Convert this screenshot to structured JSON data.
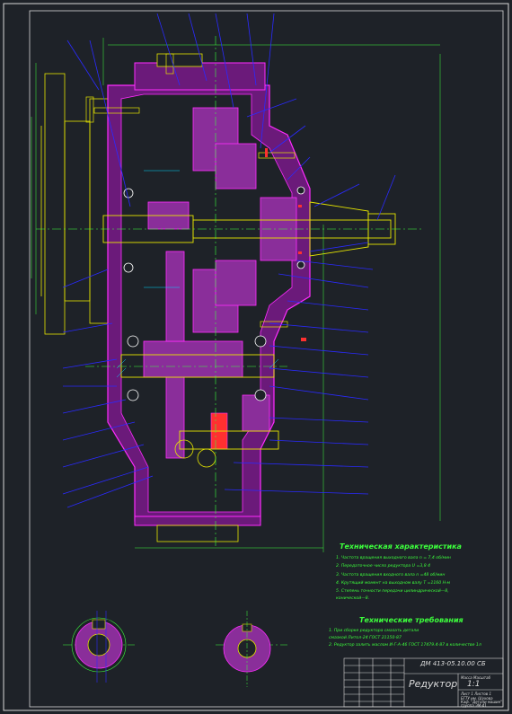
{
  "colors": {
    "background": "#1e2228",
    "frame": "#d8d8d8",
    "body_fill": "#7a1e8c",
    "body_line": "#ff2cff",
    "gear_fill": "#8a2e9a",
    "shaft_line": "#e6e600",
    "leader": "#2a2aff",
    "hatch": "#00d8ff",
    "text_green": "#3cff3c",
    "accent_red": "#ff3030",
    "title_text": "#dcdcdc"
  },
  "tech_characteristics": {
    "heading": "Техническая характеристика",
    "lines": [
      "1. Частота вращения выходного вала n  = 7,4 об/мин",
      "2. Передаточное число редуктора U =3,8 4",
      "3. Частота вращения входного вала n  =48 об/мин",
      "4. Крутящий момент на выходном валу T  =1160 Н·м",
      "5. Степень точности передачи цилиндрической—8,",
      "   конической—8."
    ]
  },
  "tech_requirements": {
    "heading": "Технические требования",
    "lines": [
      "1. При сборке редуктора смазать детали",
      "   смазкой Литол-24 ГОСТ 21150-87",
      "2. Редуктор залить маслом И-Г-А-46  ГОСТ 17479.4-87 в количестве 1л"
    ]
  },
  "title_block": {
    "document_code": "ДМ 413-05.10.00 СБ",
    "name": "Редуктор",
    "sheet_label": "Масса Масштаб",
    "scale": "1:1",
    "sheet_info": "Лист 1  Листов 1",
    "org": "БГТУ им. Шухова",
    "dept": "Каф. \"Детали машин\"",
    "group": "группа ЭМ-41"
  }
}
